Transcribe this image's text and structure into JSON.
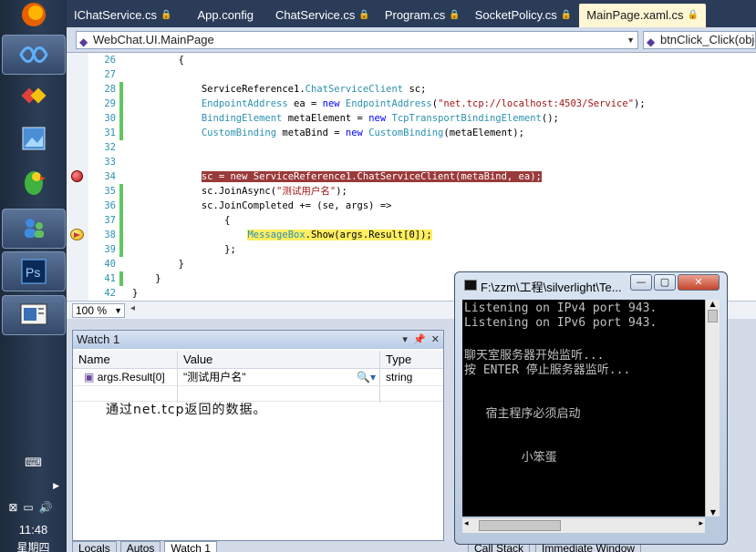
{
  "taskbar": {
    "icons": [
      "firefox-icon",
      "visual-studio-icon",
      "windows-live-icon",
      "image-viewer-icon",
      "parrot-icon",
      "messenger-icon",
      "photoshop-icon",
      "document-icon"
    ],
    "clock": "11:48",
    "weekday": "星期四"
  },
  "editor_tabs": [
    {
      "label": "IChatService.cs",
      "locked": true
    },
    {
      "label": "App.config",
      "locked": false
    },
    {
      "label": "ChatService.cs",
      "locked": true
    },
    {
      "label": "Program.cs",
      "locked": true
    },
    {
      "label": "SocketPolicy.cs",
      "locked": true
    },
    {
      "label": "MainPage.xaml.cs",
      "locked": true,
      "active": true
    }
  ],
  "navbar": {
    "class_dropdown": "WebChat.UI.MainPage",
    "member_dropdown": "btnClick_Click(obje"
  },
  "code": {
    "lines": [
      {
        "n": "26",
        "text": "        {"
      },
      {
        "n": "27",
        "text": ""
      },
      {
        "n": "28",
        "text": "            ServiceReference1.ChatServiceClient sc;",
        "changed": true
      },
      {
        "n": "29",
        "text": "            EndpointAddress ea = new EndpointAddress(\"net.tcp://localhost:4503/Service\");",
        "changed": true
      },
      {
        "n": "30",
        "text": "            BindingElement metaElement = new TcpTransportBindingElement();",
        "changed": true
      },
      {
        "n": "31",
        "text": "            CustomBinding metaBind = new CustomBinding(metaElement);",
        "changed": true
      },
      {
        "n": "32",
        "text": ""
      },
      {
        "n": "33",
        "text": ""
      },
      {
        "n": "34",
        "text": "            sc = new ServiceReference1.ChatServiceClient(metaBind, ea);",
        "breakpoint": true
      },
      {
        "n": "35",
        "text": "            sc.JoinAsync(\"测试用户名\");",
        "changed": true
      },
      {
        "n": "36",
        "text": "            sc.JoinCompleted += (se, args) =>",
        "changed": true
      },
      {
        "n": "37",
        "text": "                {",
        "changed": true
      },
      {
        "n": "38",
        "text": "                    MessageBox.Show(args.Result[0]);",
        "current": true,
        "changed": true
      },
      {
        "n": "39",
        "text": "                };",
        "changed": true
      },
      {
        "n": "40",
        "text": "        }"
      },
      {
        "n": "41",
        "text": "    }",
        "changed": true
      },
      {
        "n": "42",
        "text": "}"
      }
    ]
  },
  "zoom": "100 %",
  "watch": {
    "title": "Watch 1",
    "columns": [
      "Name",
      "Value",
      "Type"
    ],
    "rows": [
      {
        "name": "args.Result[0]",
        "value": "\"测试用户名\"",
        "type": "string"
      }
    ],
    "note": "通过net.tcp返回的数据。"
  },
  "bottom_tabs": [
    "Locals",
    "Autos",
    "Watch 1"
  ],
  "bottom_tabs_right": [
    "Call Stack",
    "Immediate Window"
  ],
  "console": {
    "title": "F:\\zzm\\工程\\silverlight\\Te...",
    "lines": [
      "Listening on IPv4 port 943.",
      "Listening on IPv6 port 943.",
      "",
      "聊天室服务器开始监听...",
      "按 ENTER 停止服务器监听...",
      "",
      "",
      "   宿主程序必须启动",
      "",
      "",
      "        小笨蛋"
    ]
  }
}
